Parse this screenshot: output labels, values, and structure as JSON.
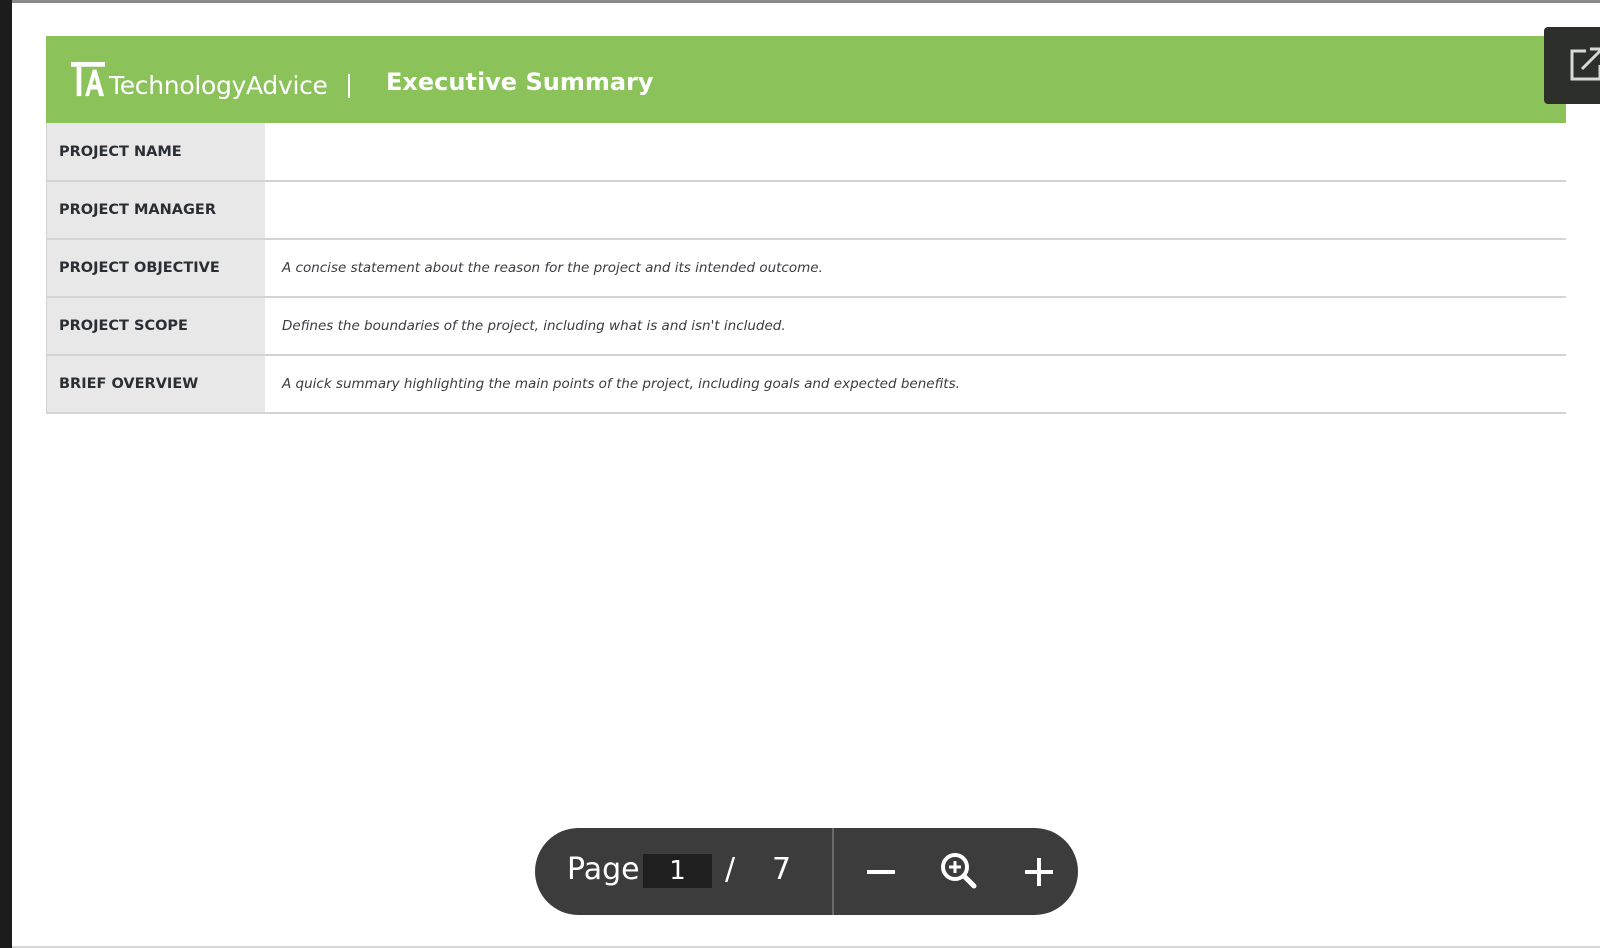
{
  "document": {
    "brand_mark": "TA",
    "brand_name": "TechnologyAdvice",
    "title": "Executive Summary",
    "header_color": "#8bc25a",
    "rows": [
      {
        "label": "PROJECT NAME",
        "value": ""
      },
      {
        "label": "PROJECT MANAGER",
        "value": ""
      },
      {
        "label": "PROJECT OBJECTIVE",
        "value": "A concise statement about the reason for the project and its intended outcome."
      },
      {
        "label": "PROJECT SCOPE",
        "value": "Defines the boundaries of the project, including what is and isn't included."
      },
      {
        "label": "BRIEF OVERVIEW",
        "value": "A quick summary highlighting the main points of the project, including goals and expected benefits."
      }
    ]
  },
  "toolbar": {
    "page_label": "Page",
    "current_page": "1",
    "separator": "/",
    "total_pages": "7",
    "zoom_out_icon": "minus-icon",
    "zoom_icon": "magnifier-plus-icon",
    "zoom_in_icon": "plus-icon"
  },
  "popout": {
    "icon": "external-link-icon"
  }
}
